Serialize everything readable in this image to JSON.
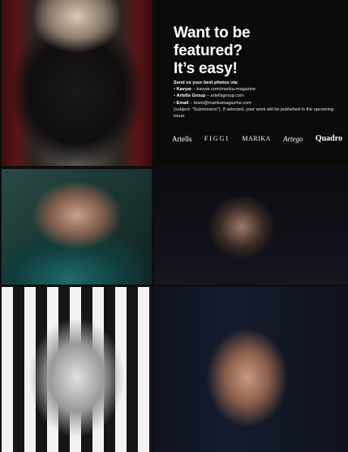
{
  "promo": {
    "title_line1": "Want to be",
    "title_line2": "featured?",
    "title_line3": "It’s easy!",
    "lead": "Send us your best photos via:",
    "kavyar_label": "Kavyar",
    "kavyar_text": " – kavyar.com/marika-magazine",
    "artells_label": "Artells Group",
    "artells_text": " – artellsgroup.com",
    "email_label": "Email",
    "email_text": " – team@marikamagazine.com",
    "note": "(subject: \"Submission\"). If selected, your work will be published in the upcoming issue."
  },
  "logos": {
    "artells": "Artells",
    "figgi": "FIGGI",
    "marika": "MARIKA",
    "artego": "Artego",
    "quadro": "Quadro"
  }
}
